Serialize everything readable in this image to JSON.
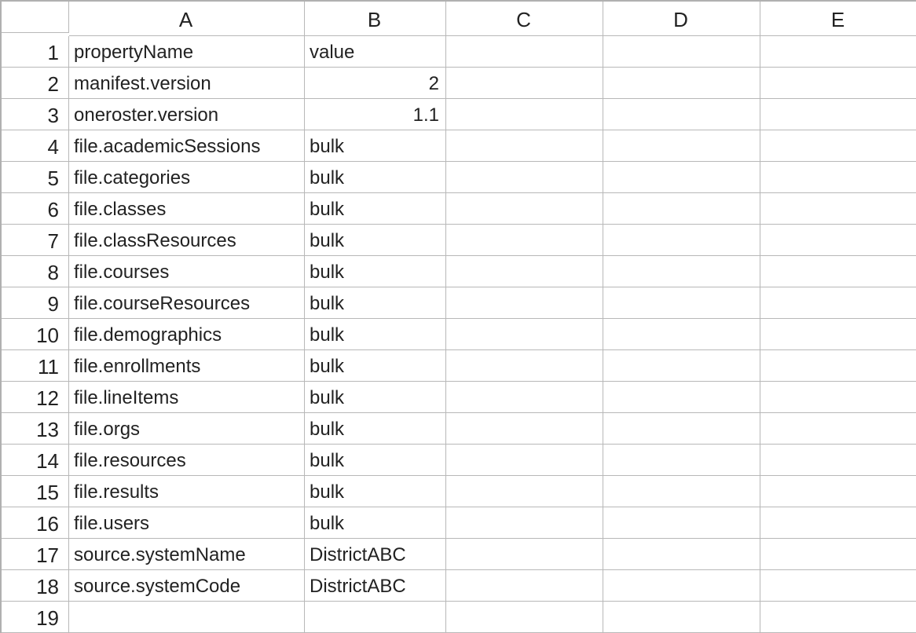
{
  "spreadsheet": {
    "columns": [
      "A",
      "B",
      "C",
      "D",
      "E"
    ],
    "rowNumbers": [
      "1",
      "2",
      "3",
      "4",
      "5",
      "6",
      "7",
      "8",
      "9",
      "10",
      "11",
      "12",
      "13",
      "14",
      "15",
      "16",
      "17",
      "18",
      "19"
    ],
    "cells": {
      "A1": "propertyName",
      "B1": "value",
      "A2": "manifest.version",
      "B2": "2",
      "A3": "oneroster.version",
      "B3": "1.1",
      "A4": "file.academicSessions",
      "B4": "bulk",
      "A5": "file.categories",
      "B5": "bulk",
      "A6": "file.classes",
      "B6": "bulk",
      "A7": "file.classResources",
      "B7": "bulk",
      "A8": "file.courses",
      "B8": "bulk",
      "A9": "file.courseResources",
      "B9": "bulk",
      "A10": "file.demographics",
      "B10": "bulk",
      "A11": "file.enrollments",
      "B11": "bulk",
      "A12": "file.lineItems",
      "B12": "bulk",
      "A13": "file.orgs",
      "B13": "bulk",
      "A14": "file.resources",
      "B14": "bulk",
      "A15": "file.results",
      "B15": "bulk",
      "A16": "file.users",
      "B16": "bulk",
      "A17": "source.systemName",
      "B17": "DistrictABC",
      "A18": "source.systemCode",
      "B18": "DistrictABC"
    },
    "numericCells": [
      "B2",
      "B3"
    ]
  }
}
